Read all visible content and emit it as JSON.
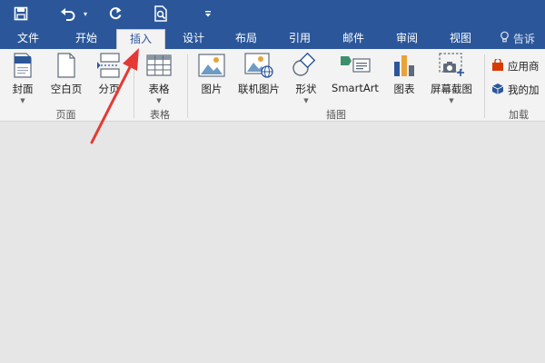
{
  "tabs": [
    "文件",
    "开始",
    "插入",
    "设计",
    "布局",
    "引用",
    "邮件",
    "审阅",
    "视图"
  ],
  "active_tab": "插入",
  "tell_me": "告诉",
  "ribbon": {
    "pages_group": {
      "label": "页面",
      "cover": "封面",
      "blank_page": "空白页",
      "page_break": "分页"
    },
    "tables_group": {
      "label": "表格",
      "table": "表格"
    },
    "illustrations_group": {
      "label": "插图",
      "pictures": "图片",
      "online_pictures": "联机图片",
      "shapes": "形状",
      "smartart": "SmartArt",
      "chart": "图表",
      "screenshot": "屏幕截图"
    },
    "addins_group": {
      "label": "加载",
      "store": "应用商",
      "my_addins": "我的加"
    }
  },
  "colors": {
    "title_bar": "#2b579a",
    "ribbon_bg": "#f3f3f3",
    "doc_bg": "#e6e6e6",
    "annotation_arrow": "#e53935"
  },
  "icons": {
    "save": "save-icon",
    "undo": "undo-icon",
    "redo": "redo-icon",
    "print_preview": "print-preview-icon",
    "customize": "customize-quick-access-icon",
    "tell_me": "lightbulb-icon"
  }
}
